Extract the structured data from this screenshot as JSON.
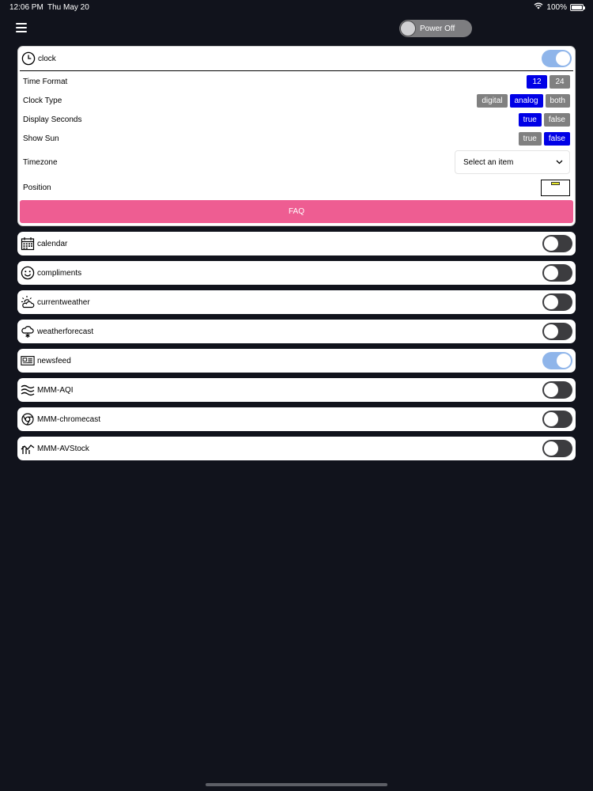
{
  "status_bar": {
    "time": "12:06 PM",
    "date": "Thu May 20",
    "battery": "100%"
  },
  "header": {
    "power_label": "Power Off"
  },
  "clock": {
    "title": "clock",
    "enabled": true,
    "settings": {
      "time_format": {
        "label": "Time Format",
        "options": [
          "12",
          "24"
        ],
        "selected": "12"
      },
      "clock_type": {
        "label": "Clock Type",
        "options": [
          "digital",
          "analog",
          "both"
        ],
        "selected": "analog"
      },
      "display_seconds": {
        "label": "Display Seconds",
        "options": [
          "true",
          "false"
        ],
        "selected": "true"
      },
      "show_sun": {
        "label": "Show Sun",
        "options": [
          "true",
          "false"
        ],
        "selected": "false"
      },
      "timezone": {
        "label": "Timezone",
        "placeholder": "Select an item"
      },
      "position": {
        "label": "Position"
      }
    },
    "faq_label": "FAQ"
  },
  "modules": [
    {
      "title": "calendar",
      "icon": "calendar-icon",
      "enabled": false
    },
    {
      "title": "compliments",
      "icon": "smiley-icon",
      "enabled": false
    },
    {
      "title": "currentweather",
      "icon": "sun-cloud-icon",
      "enabled": false
    },
    {
      "title": "weatherforecast",
      "icon": "cloud-snow-icon",
      "enabled": false
    },
    {
      "title": "newsfeed",
      "icon": "newspaper-icon",
      "enabled": true
    },
    {
      "title": "MMM-AQI",
      "icon": "waves-icon",
      "enabled": false
    },
    {
      "title": "MMM-chromecast",
      "icon": "chrome-icon",
      "enabled": false
    },
    {
      "title": "MMM-AVStock",
      "icon": "stock-chart-icon",
      "enabled": false
    }
  ],
  "colors": {
    "background": "#11131c",
    "active_option": "#0000e6",
    "inactive_option": "#808080",
    "toggle_on": "#8fb5ea",
    "toggle_off": "#3c3c3f",
    "faq_button": "#ee5d92"
  }
}
